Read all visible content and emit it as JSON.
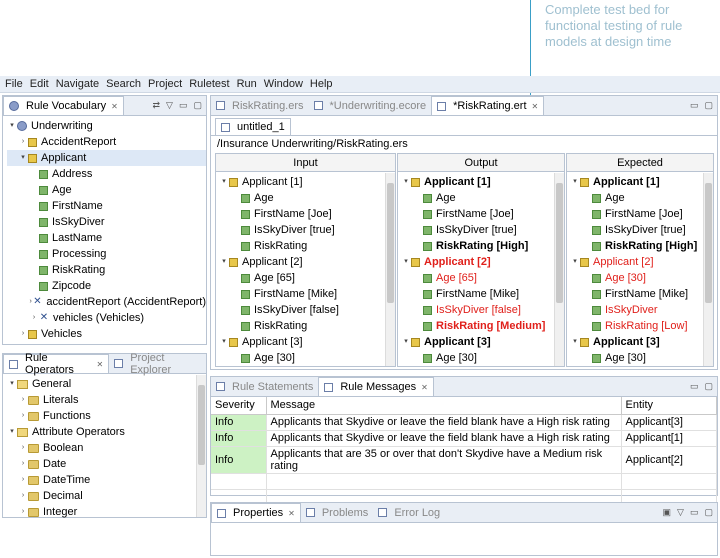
{
  "annotation": {
    "text": "Complete test bed for functional testing of rule models at design time"
  },
  "menu": [
    "File",
    "Edit",
    "Navigate",
    "Search",
    "Project",
    "Ruletest",
    "Run",
    "Window",
    "Help"
  ],
  "vocab_panel": {
    "tab_label": "Rule Vocabulary",
    "tree": [
      {
        "label": "Underwriting",
        "depth": 0,
        "toggle": "▾",
        "icon": "vocab"
      },
      {
        "label": "AccidentReport",
        "depth": 1,
        "toggle": "›",
        "icon": "entity"
      },
      {
        "label": "Applicant",
        "depth": 1,
        "toggle": "▾",
        "icon": "entity",
        "selected": true
      },
      {
        "label": "Address",
        "depth": 2,
        "icon": "attr"
      },
      {
        "label": "Age",
        "depth": 2,
        "icon": "attr"
      },
      {
        "label": "FirstName",
        "depth": 2,
        "icon": "attr"
      },
      {
        "label": "IsSkyDiver",
        "depth": 2,
        "icon": "attr"
      },
      {
        "label": "LastName",
        "depth": 2,
        "icon": "attr"
      },
      {
        "label": "Processing",
        "depth": 2,
        "icon": "attr"
      },
      {
        "label": "RiskRating",
        "depth": 2,
        "icon": "attr"
      },
      {
        "label": "Zipcode",
        "depth": 2,
        "icon": "attr"
      },
      {
        "label": "accidentReport (AccidentReport)",
        "depth": 2,
        "toggle": "›",
        "icon": "assoc"
      },
      {
        "label": "vehicles (Vehicles)",
        "depth": 2,
        "toggle": "›",
        "icon": "assoc"
      },
      {
        "label": "Vehicles",
        "depth": 1,
        "toggle": "›",
        "icon": "entity"
      }
    ]
  },
  "operators_panel": {
    "tab_label": "Rule Operators",
    "tab2_label": "Project Explorer",
    "tree": [
      {
        "label": "General",
        "depth": 0,
        "toggle": "▾",
        "icon": "folder-open"
      },
      {
        "label": "Literals",
        "depth": 1,
        "toggle": "›",
        "icon": "folder"
      },
      {
        "label": "Functions",
        "depth": 1,
        "toggle": "›",
        "icon": "folder"
      },
      {
        "label": "Attribute Operators",
        "depth": 0,
        "toggle": "▾",
        "icon": "folder-open"
      },
      {
        "label": "Boolean",
        "depth": 1,
        "toggle": "›",
        "icon": "folder"
      },
      {
        "label": "Date",
        "depth": 1,
        "toggle": "›",
        "icon": "folder"
      },
      {
        "label": "DateTime",
        "depth": 1,
        "toggle": "›",
        "icon": "folder"
      },
      {
        "label": "Decimal",
        "depth": 1,
        "toggle": "›",
        "icon": "folder"
      },
      {
        "label": "Integer",
        "depth": 1,
        "toggle": "›",
        "icon": "folder"
      }
    ]
  },
  "editor": {
    "tabs": [
      {
        "label": "RiskRating.ers",
        "active": false
      },
      {
        "label": "*Underwriting.ecore",
        "active": false
      },
      {
        "label": "*RiskRating.ert",
        "active": true
      }
    ],
    "subtab": "untitled_1",
    "path": "/Insurance Underwriting/RiskRating.ers",
    "columns": {
      "input": {
        "header": "Input",
        "rows": [
          {
            "label": "Applicant [1]",
            "depth": 0,
            "toggle": "▾",
            "icon": "entity"
          },
          {
            "label": "Age",
            "depth": 1,
            "icon": "attr"
          },
          {
            "label": "FirstName [Joe]",
            "depth": 1,
            "icon": "attr"
          },
          {
            "label": "IsSkyDiver [true]",
            "depth": 1,
            "icon": "attr"
          },
          {
            "label": "RiskRating",
            "depth": 1,
            "icon": "attr"
          },
          {
            "label": "Applicant [2]",
            "depth": 0,
            "toggle": "▾",
            "icon": "entity"
          },
          {
            "label": "Age [65]",
            "depth": 1,
            "icon": "attr"
          },
          {
            "label": "FirstName [Mike]",
            "depth": 1,
            "icon": "attr"
          },
          {
            "label": "IsSkyDiver [false]",
            "depth": 1,
            "icon": "attr"
          },
          {
            "label": "RiskRating",
            "depth": 1,
            "icon": "attr"
          },
          {
            "label": "Applicant [3]",
            "depth": 0,
            "toggle": "▾",
            "icon": "entity"
          },
          {
            "label": "Age [30]",
            "depth": 1,
            "icon": "attr"
          }
        ]
      },
      "output": {
        "header": "Output",
        "rows": [
          {
            "label": "Applicant [1]",
            "depth": 0,
            "toggle": "▾",
            "icon": "entity",
            "bold": true
          },
          {
            "label": "Age",
            "depth": 1,
            "icon": "attr"
          },
          {
            "label": "FirstName [Joe]",
            "depth": 1,
            "icon": "attr"
          },
          {
            "label": "IsSkyDiver [true]",
            "depth": 1,
            "icon": "attr"
          },
          {
            "label": "RiskRating [High]",
            "depth": 1,
            "icon": "attr",
            "bold": true
          },
          {
            "label": "Applicant [2]",
            "depth": 0,
            "toggle": "▾",
            "icon": "entity",
            "bold": true,
            "red": true
          },
          {
            "label": "Age [65]",
            "depth": 1,
            "icon": "attr",
            "red": true
          },
          {
            "label": "FirstName [Mike]",
            "depth": 1,
            "icon": "attr"
          },
          {
            "label": "IsSkyDiver [false]",
            "depth": 1,
            "icon": "attr",
            "red": true
          },
          {
            "label": "RiskRating [Medium]",
            "depth": 1,
            "icon": "attr",
            "bold": true,
            "red": true
          },
          {
            "label": "Applicant [3]",
            "depth": 0,
            "toggle": "▾",
            "icon": "entity",
            "bold": true
          },
          {
            "label": "Age [30]",
            "depth": 1,
            "icon": "attr"
          }
        ]
      },
      "expected": {
        "header": "Expected",
        "rows": [
          {
            "label": "Applicant [1]",
            "depth": 0,
            "toggle": "▾",
            "icon": "entity",
            "bold": true
          },
          {
            "label": "Age",
            "depth": 1,
            "icon": "attr"
          },
          {
            "label": "FirstName [Joe]",
            "depth": 1,
            "icon": "attr"
          },
          {
            "label": "IsSkyDiver [true]",
            "depth": 1,
            "icon": "attr"
          },
          {
            "label": "RiskRating [High]",
            "depth": 1,
            "icon": "attr",
            "bold": true
          },
          {
            "label": "Applicant [2]",
            "depth": 0,
            "toggle": "▾",
            "icon": "entity",
            "red": true
          },
          {
            "label": "Age [30]",
            "depth": 1,
            "icon": "attr",
            "red": true
          },
          {
            "label": "FirstName [Mike]",
            "depth": 1,
            "icon": "attr"
          },
          {
            "label": "IsSkyDiver",
            "depth": 1,
            "icon": "attr",
            "red": true
          },
          {
            "label": "RiskRating [Low]",
            "depth": 1,
            "icon": "attr",
            "red": true
          },
          {
            "label": "Applicant [3]",
            "depth": 0,
            "toggle": "▾",
            "icon": "entity",
            "bold": true
          },
          {
            "label": "Age [30]",
            "depth": 1,
            "icon": "attr"
          }
        ]
      }
    }
  },
  "messages_panel": {
    "tabs": [
      {
        "label": "Rule Statements",
        "active": false
      },
      {
        "label": "Rule Messages",
        "active": true
      }
    ],
    "headers": [
      "Severity",
      "Message",
      "Entity"
    ],
    "rows": [
      [
        "Info",
        "Applicants that Skydive or leave the field blank have a High risk rating",
        "Applicant[3]"
      ],
      [
        "Info",
        "Applicants that Skydive or leave the field blank have a High risk rating",
        "Applicant[1]"
      ],
      [
        "Info",
        "Applicants that are 35 or over that don't Skydive have a Medium risk rating",
        "Applicant[2]"
      ]
    ]
  },
  "bottom_panel": {
    "tabs": [
      {
        "label": "Properties",
        "active": true
      },
      {
        "label": "Problems",
        "active": false
      },
      {
        "label": "Error Log",
        "active": false
      }
    ]
  },
  "colors": {
    "accent": "#1f7fae",
    "error": "#e0201b",
    "info_bg": "#cdf2c4"
  }
}
